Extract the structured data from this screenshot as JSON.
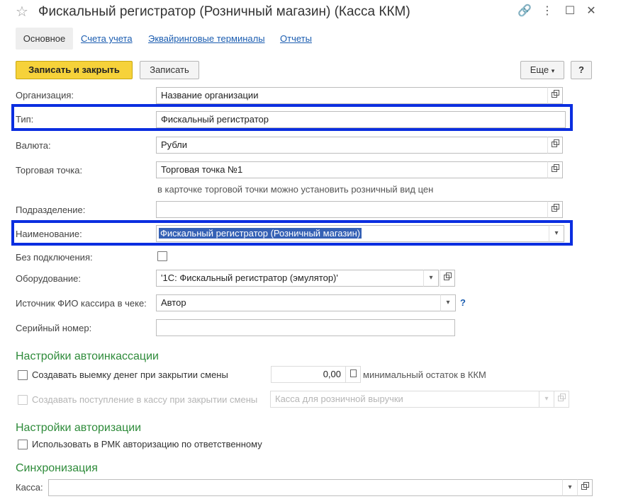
{
  "window": {
    "title": "Фискальный регистратор (Розничный магазин) (Касса ККМ)",
    "controls": {
      "link": "🔗",
      "more": "⋮",
      "maximize": "☐",
      "close": "✕"
    }
  },
  "tabs": [
    {
      "label": "Основное",
      "active": true
    },
    {
      "label": "Счета учета",
      "active": false
    },
    {
      "label": "Эквайринговые терминалы",
      "active": false
    },
    {
      "label": "Отчеты",
      "active": false
    }
  ],
  "toolbar": {
    "save_close_label": "Записать и закрыть",
    "save_label": "Записать",
    "more_label": "Еще",
    "help_label": "?"
  },
  "form": {
    "organization": {
      "label": "Организация:",
      "value": "Название организации"
    },
    "type": {
      "label": "Тип:",
      "value": "Фискальный регистратор"
    },
    "currency": {
      "label": "Валюта:",
      "value": "Рубли"
    },
    "point": {
      "label": "Торговая точка:",
      "value": "Торговая точка №1",
      "hint": "в карточке торговой точки можно установить розничный вид цен"
    },
    "department": {
      "label": "Подразделение:",
      "value": ""
    },
    "name": {
      "label": "Наименование:",
      "value": "Фискальный регистратор (Розничный магазин)"
    },
    "no_connection": {
      "label": "Без подключения:",
      "checked": false
    },
    "equipment": {
      "label": "Оборудование:",
      "value": "'1С: Фискальный регистратор (эмулятор)'"
    },
    "cashier_source": {
      "label": "Источник ФИО кассира в чеке:",
      "value": "Автор",
      "help": "?"
    },
    "serial": {
      "label": "Серийный номер:",
      "value": ""
    }
  },
  "autocollect": {
    "title": "Настройки автоинкассации",
    "withdraw": {
      "label": "Создавать выемку денег при закрытии смены",
      "checked": false,
      "amount": "0,00",
      "suffix": "минимальный остаток в ККМ"
    },
    "receipt": {
      "label": "Создавать поступление в кассу при закрытии смены",
      "checked": false,
      "placeholder": "Касса для розничной выручки"
    }
  },
  "auth": {
    "title": "Настройки авторизации",
    "use_rmk": {
      "label": "Использовать в РМК авторизацию по ответственному",
      "checked": false
    }
  },
  "sync": {
    "title": "Синхронизация",
    "cash": {
      "label": "Касса:",
      "value": ""
    }
  },
  "colors": {
    "accent_link": "#1a5cb0",
    "primary_button": "#f6d23a",
    "section": "#2e8b3a",
    "highlight_box": "#0b2ee0",
    "selection": "#3561b5"
  }
}
